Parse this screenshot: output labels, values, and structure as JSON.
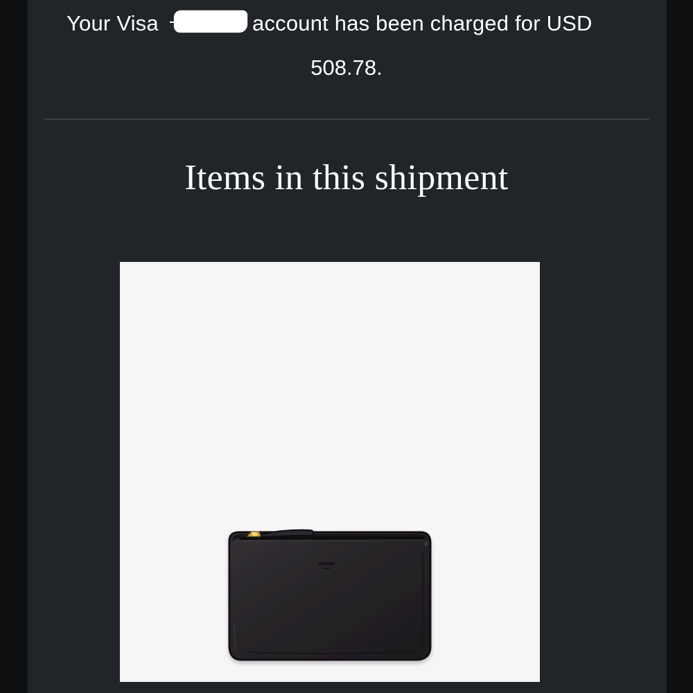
{
  "email": {
    "charge_prefix": "Your Visa",
    "charge_suffix": "account has been charged for USD",
    "amount": "508.78.",
    "section_title": "Items in this shipment"
  },
  "colors": {
    "page_background": "#0f1011",
    "email_background": "#212428",
    "text": "#ffffff",
    "divider": "#3b4046",
    "product_background": "#f6f6f6",
    "wallet": "#262427",
    "zipper_pull": "#c8a449"
  },
  "icons": {
    "redaction": "redaction-mark",
    "product": "black-zip-pouch"
  }
}
